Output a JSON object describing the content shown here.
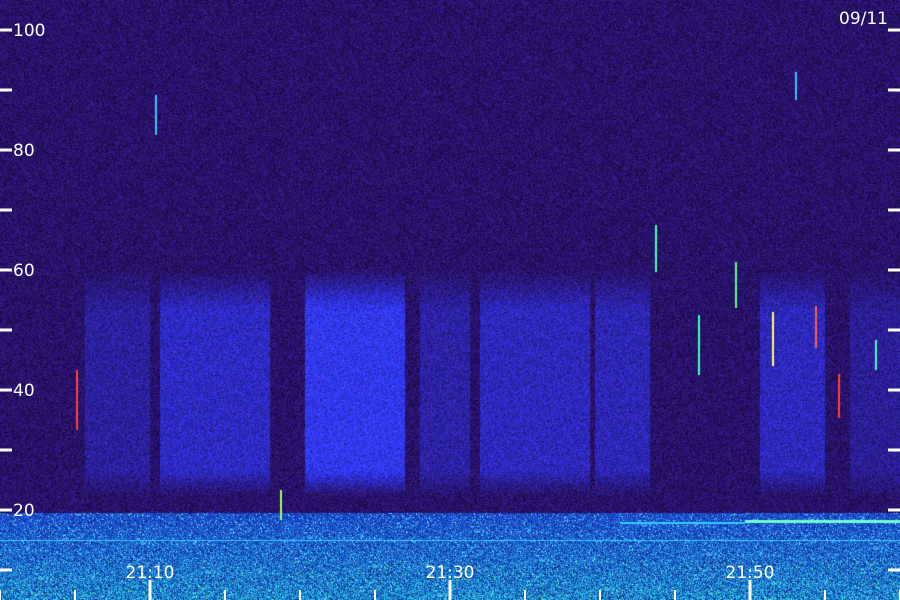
{
  "chart_data": {
    "type": "heatmap",
    "date": "09/11",
    "y_ticks": [
      {
        "value": 20,
        "label": "20"
      },
      {
        "value": 40,
        "label": "40"
      },
      {
        "value": 60,
        "label": "60"
      },
      {
        "value": 80,
        "label": "80"
      },
      {
        "value": 100,
        "label": "100"
      }
    ],
    "y_minor_ticks": [
      10,
      30,
      50,
      70,
      90
    ],
    "ylim": [
      0,
      105
    ],
    "x_ticks": [
      {
        "value": 10,
        "label": "21:10"
      },
      {
        "value": 30,
        "label": "21:30"
      },
      {
        "value": 50,
        "label": "21:50"
      }
    ],
    "xlim": [
      0,
      60
    ],
    "colors": {
      "background": "#1e0c52",
      "band_blue": "#2a3cff",
      "low_band": "#1aa0ff",
      "text": "#ffffff"
    }
  }
}
